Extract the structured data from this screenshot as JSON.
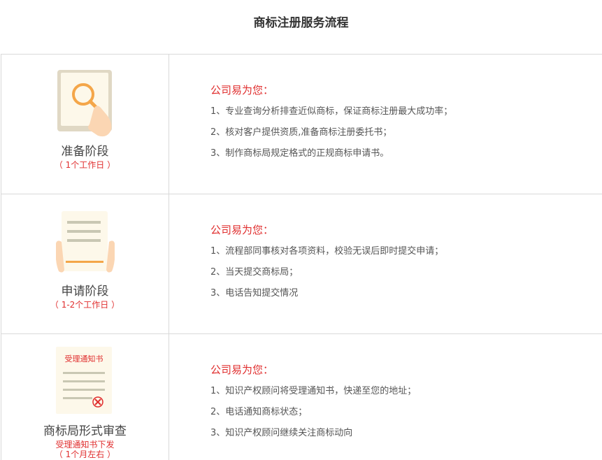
{
  "page_title": "商标注册服务流程",
  "colors": {
    "accent_red": "#e02e2e",
    "border": "#d9d9d9"
  },
  "steps": [
    {
      "icon": "search-document-icon",
      "name": "准备阶段",
      "time": "（ 1个工作日 ）",
      "heading": "公司易为您：",
      "items": [
        "1、专业查询分析排查近似商标，保证商标注册最大成功率；",
        "2、核对客户提供资质,准备商标注册委托书；",
        "3、制作商标局规定格式的正规商标申请书。"
      ]
    },
    {
      "icon": "application-document-icon",
      "name": "申请阶段",
      "time": "（ 1-2个工作日 ）",
      "heading": "公司易为您：",
      "items": [
        "1、流程部同事核对各项资料，校验无误后即时提交申请；",
        "2、当天提交商标局；",
        "3、电话告知提交情况"
      ]
    },
    {
      "icon": "acceptance-notice-icon",
      "icon_text": "受理通知书",
      "name": "商标局形式审查",
      "time": "受理通知书下发",
      "time2": "（ 1个月左右 ）",
      "heading": "公司易为您：",
      "items": [
        "1、知识产权顾问将受理通知书，快递至您的地址；",
        "2、电话通知商标状态；",
        "3、知识产权顾问继续关注商标动向"
      ]
    }
  ]
}
